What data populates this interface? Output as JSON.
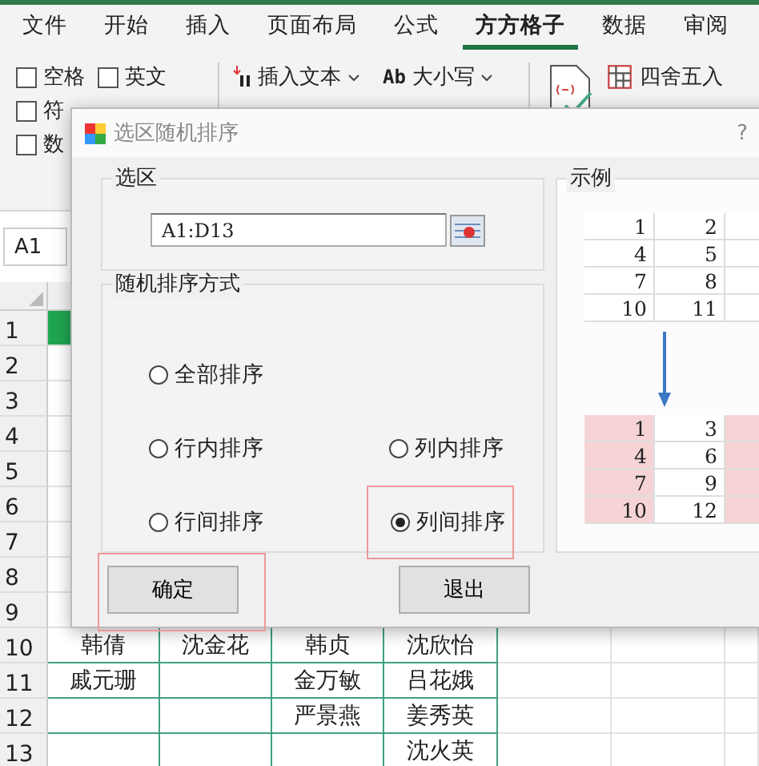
{
  "ribbon": {
    "tabs": [
      {
        "label": "文件",
        "selected": false
      },
      {
        "label": "开始",
        "selected": false
      },
      {
        "label": "插入",
        "selected": false
      },
      {
        "label": "页面布局",
        "selected": false
      },
      {
        "label": "公式",
        "selected": false
      },
      {
        "label": "方方格子",
        "selected": true
      },
      {
        "label": "数据",
        "selected": false
      },
      {
        "label": "审阅",
        "selected": false
      }
    ],
    "checkbox_rows": [
      [
        {
          "label": "空格",
          "checked": false
        },
        {
          "label": "英文",
          "checked": false
        }
      ],
      [
        {
          "label": "符",
          "checked": false
        }
      ],
      [
        {
          "label": "数",
          "checked": false
        }
      ]
    ],
    "text_commands": [
      {
        "label": "插入文本",
        "kind": "insert"
      },
      {
        "label": "大小写",
        "prefix": "Ab",
        "kind": "case"
      }
    ],
    "round_command": {
      "label": "四舍五入"
    }
  },
  "name_box": "A1",
  "sheet": {
    "rows": [
      {
        "number": "1",
        "selected": true,
        "cells": [
          null,
          null,
          null,
          null
        ]
      },
      {
        "number": "2",
        "selected": false,
        "cells": [
          null,
          null,
          null,
          null
        ]
      },
      {
        "number": "3",
        "selected": false,
        "cells": [
          null,
          null,
          null,
          null
        ]
      },
      {
        "number": "4",
        "selected": false,
        "cells": [
          null,
          null,
          null,
          null
        ]
      },
      {
        "number": "5",
        "selected": false,
        "cells": [
          null,
          null,
          null,
          null
        ]
      },
      {
        "number": "6",
        "selected": false,
        "cells": [
          null,
          null,
          null,
          null
        ]
      },
      {
        "number": "7",
        "selected": false,
        "cells": [
          null,
          null,
          null,
          null
        ]
      },
      {
        "number": "8",
        "selected": false,
        "cells": [
          null,
          null,
          null,
          null
        ]
      },
      {
        "number": "9",
        "selected": false,
        "cells": [
          null,
          null,
          null,
          null
        ]
      },
      {
        "number": "10",
        "selected": false,
        "cells": [
          "韩倩",
          "沈金花",
          "韩贞",
          "沈欣怡"
        ]
      },
      {
        "number": "11",
        "selected": false,
        "cells": [
          "戚元珊",
          null,
          "金万敏",
          "吕花娥"
        ]
      },
      {
        "number": "12",
        "selected": false,
        "cells": [
          null,
          null,
          "严景燕",
          "姜秀英"
        ]
      },
      {
        "number": "13",
        "selected": false,
        "cells": [
          null,
          null,
          null,
          "沈火英"
        ]
      }
    ]
  },
  "dialog": {
    "title": "选区随机排序",
    "help": "?",
    "range_group": {
      "label": "选区",
      "value": "A1:D13"
    },
    "mode_group": {
      "label": "随机排序方式",
      "rows": [
        [
          {
            "label": "全部排序",
            "selected": false,
            "highlighted": false
          }
        ],
        [
          {
            "label": "行内排序",
            "selected": false,
            "highlighted": false
          },
          {
            "label": "列内排序",
            "selected": false,
            "highlighted": false
          }
        ],
        [
          {
            "label": "行间排序",
            "selected": false,
            "highlighted": false
          },
          {
            "label": "列间排序",
            "selected": true,
            "highlighted": true
          }
        ]
      ]
    },
    "example_group": {
      "label": "示例",
      "before": [
        [
          {
            "text": "1"
          },
          {
            "text": "2"
          }
        ],
        [
          {
            "text": "4"
          },
          {
            "text": "5"
          }
        ],
        [
          {
            "text": "7"
          },
          {
            "text": "8"
          }
        ],
        [
          {
            "text": "10"
          },
          {
            "text": "11"
          }
        ]
      ],
      "after": [
        [
          {
            "text": "1",
            "highlighted": true
          },
          {
            "text": "3",
            "highlighted": false
          },
          {
            "highlighted": true
          }
        ],
        [
          {
            "text": "4",
            "highlighted": true
          },
          {
            "text": "6",
            "highlighted": false
          },
          {
            "highlighted": true
          }
        ],
        [
          {
            "text": "7",
            "highlighted": true
          },
          {
            "text": "9",
            "highlighted": false
          },
          {
            "highlighted": true
          }
        ],
        [
          {
            "text": "10",
            "highlighted": true
          },
          {
            "text": "12",
            "highlighted": false
          },
          {
            "highlighted": true
          }
        ]
      ]
    },
    "buttons": [
      {
        "label": "确定",
        "highlighted": true
      },
      {
        "label": "退出",
        "highlighted": false
      }
    ]
  }
}
